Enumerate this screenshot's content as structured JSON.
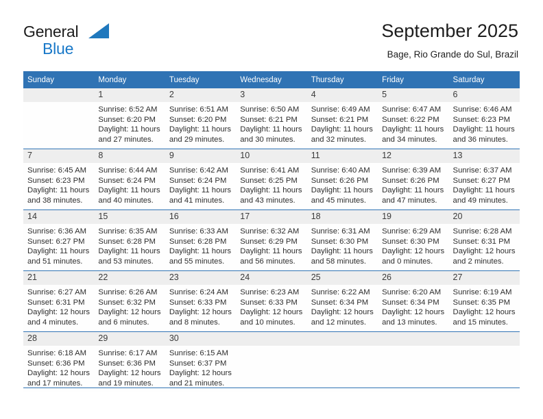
{
  "brand": {
    "name_top": "General",
    "name_bottom": "Blue",
    "triangle_icon": "blue-triangle-icon",
    "color_top": "#1c1c1c",
    "color_bottom": "#1878c8"
  },
  "header": {
    "title": "September 2025",
    "subtitle": "Bage, Rio Grande do Sul, Brazil"
  },
  "theme": {
    "header_blue": "#3073b4",
    "daynum_band": "#eeeeee",
    "text": "#2d2d2d"
  },
  "weekdays": [
    "Sunday",
    "Monday",
    "Tuesday",
    "Wednesday",
    "Thursday",
    "Friday",
    "Saturday"
  ],
  "weeks": [
    [
      {
        "day": "",
        "sunrise": "",
        "sunset": "",
        "daylight_line1": "",
        "daylight_line2": ""
      },
      {
        "day": "1",
        "sunrise": "Sunrise: 6:52 AM",
        "sunset": "Sunset: 6:20 PM",
        "daylight_line1": "Daylight: 11 hours",
        "daylight_line2": "and 27 minutes."
      },
      {
        "day": "2",
        "sunrise": "Sunrise: 6:51 AM",
        "sunset": "Sunset: 6:20 PM",
        "daylight_line1": "Daylight: 11 hours",
        "daylight_line2": "and 29 minutes."
      },
      {
        "day": "3",
        "sunrise": "Sunrise: 6:50 AM",
        "sunset": "Sunset: 6:21 PM",
        "daylight_line1": "Daylight: 11 hours",
        "daylight_line2": "and 30 minutes."
      },
      {
        "day": "4",
        "sunrise": "Sunrise: 6:49 AM",
        "sunset": "Sunset: 6:21 PM",
        "daylight_line1": "Daylight: 11 hours",
        "daylight_line2": "and 32 minutes."
      },
      {
        "day": "5",
        "sunrise": "Sunrise: 6:47 AM",
        "sunset": "Sunset: 6:22 PM",
        "daylight_line1": "Daylight: 11 hours",
        "daylight_line2": "and 34 minutes."
      },
      {
        "day": "6",
        "sunrise": "Sunrise: 6:46 AM",
        "sunset": "Sunset: 6:23 PM",
        "daylight_line1": "Daylight: 11 hours",
        "daylight_line2": "and 36 minutes."
      }
    ],
    [
      {
        "day": "7",
        "sunrise": "Sunrise: 6:45 AM",
        "sunset": "Sunset: 6:23 PM",
        "daylight_line1": "Daylight: 11 hours",
        "daylight_line2": "and 38 minutes."
      },
      {
        "day": "8",
        "sunrise": "Sunrise: 6:44 AM",
        "sunset": "Sunset: 6:24 PM",
        "daylight_line1": "Daylight: 11 hours",
        "daylight_line2": "and 40 minutes."
      },
      {
        "day": "9",
        "sunrise": "Sunrise: 6:42 AM",
        "sunset": "Sunset: 6:24 PM",
        "daylight_line1": "Daylight: 11 hours",
        "daylight_line2": "and 41 minutes."
      },
      {
        "day": "10",
        "sunrise": "Sunrise: 6:41 AM",
        "sunset": "Sunset: 6:25 PM",
        "daylight_line1": "Daylight: 11 hours",
        "daylight_line2": "and 43 minutes."
      },
      {
        "day": "11",
        "sunrise": "Sunrise: 6:40 AM",
        "sunset": "Sunset: 6:26 PM",
        "daylight_line1": "Daylight: 11 hours",
        "daylight_line2": "and 45 minutes."
      },
      {
        "day": "12",
        "sunrise": "Sunrise: 6:39 AM",
        "sunset": "Sunset: 6:26 PM",
        "daylight_line1": "Daylight: 11 hours",
        "daylight_line2": "and 47 minutes."
      },
      {
        "day": "13",
        "sunrise": "Sunrise: 6:37 AM",
        "sunset": "Sunset: 6:27 PM",
        "daylight_line1": "Daylight: 11 hours",
        "daylight_line2": "and 49 minutes."
      }
    ],
    [
      {
        "day": "14",
        "sunrise": "Sunrise: 6:36 AM",
        "sunset": "Sunset: 6:27 PM",
        "daylight_line1": "Daylight: 11 hours",
        "daylight_line2": "and 51 minutes."
      },
      {
        "day": "15",
        "sunrise": "Sunrise: 6:35 AM",
        "sunset": "Sunset: 6:28 PM",
        "daylight_line1": "Daylight: 11 hours",
        "daylight_line2": "and 53 minutes."
      },
      {
        "day": "16",
        "sunrise": "Sunrise: 6:33 AM",
        "sunset": "Sunset: 6:28 PM",
        "daylight_line1": "Daylight: 11 hours",
        "daylight_line2": "and 55 minutes."
      },
      {
        "day": "17",
        "sunrise": "Sunrise: 6:32 AM",
        "sunset": "Sunset: 6:29 PM",
        "daylight_line1": "Daylight: 11 hours",
        "daylight_line2": "and 56 minutes."
      },
      {
        "day": "18",
        "sunrise": "Sunrise: 6:31 AM",
        "sunset": "Sunset: 6:30 PM",
        "daylight_line1": "Daylight: 11 hours",
        "daylight_line2": "and 58 minutes."
      },
      {
        "day": "19",
        "sunrise": "Sunrise: 6:29 AM",
        "sunset": "Sunset: 6:30 PM",
        "daylight_line1": "Daylight: 12 hours",
        "daylight_line2": "and 0 minutes."
      },
      {
        "day": "20",
        "sunrise": "Sunrise: 6:28 AM",
        "sunset": "Sunset: 6:31 PM",
        "daylight_line1": "Daylight: 12 hours",
        "daylight_line2": "and 2 minutes."
      }
    ],
    [
      {
        "day": "21",
        "sunrise": "Sunrise: 6:27 AM",
        "sunset": "Sunset: 6:31 PM",
        "daylight_line1": "Daylight: 12 hours",
        "daylight_line2": "and 4 minutes."
      },
      {
        "day": "22",
        "sunrise": "Sunrise: 6:26 AM",
        "sunset": "Sunset: 6:32 PM",
        "daylight_line1": "Daylight: 12 hours",
        "daylight_line2": "and 6 minutes."
      },
      {
        "day": "23",
        "sunrise": "Sunrise: 6:24 AM",
        "sunset": "Sunset: 6:33 PM",
        "daylight_line1": "Daylight: 12 hours",
        "daylight_line2": "and 8 minutes."
      },
      {
        "day": "24",
        "sunrise": "Sunrise: 6:23 AM",
        "sunset": "Sunset: 6:33 PM",
        "daylight_line1": "Daylight: 12 hours",
        "daylight_line2": "and 10 minutes."
      },
      {
        "day": "25",
        "sunrise": "Sunrise: 6:22 AM",
        "sunset": "Sunset: 6:34 PM",
        "daylight_line1": "Daylight: 12 hours",
        "daylight_line2": "and 12 minutes."
      },
      {
        "day": "26",
        "sunrise": "Sunrise: 6:20 AM",
        "sunset": "Sunset: 6:34 PM",
        "daylight_line1": "Daylight: 12 hours",
        "daylight_line2": "and 13 minutes."
      },
      {
        "day": "27",
        "sunrise": "Sunrise: 6:19 AM",
        "sunset": "Sunset: 6:35 PM",
        "daylight_line1": "Daylight: 12 hours",
        "daylight_line2": "and 15 minutes."
      }
    ],
    [
      {
        "day": "28",
        "sunrise": "Sunrise: 6:18 AM",
        "sunset": "Sunset: 6:36 PM",
        "daylight_line1": "Daylight: 12 hours",
        "daylight_line2": "and 17 minutes."
      },
      {
        "day": "29",
        "sunrise": "Sunrise: 6:17 AM",
        "sunset": "Sunset: 6:36 PM",
        "daylight_line1": "Daylight: 12 hours",
        "daylight_line2": "and 19 minutes."
      },
      {
        "day": "30",
        "sunrise": "Sunrise: 6:15 AM",
        "sunset": "Sunset: 6:37 PM",
        "daylight_line1": "Daylight: 12 hours",
        "daylight_line2": "and 21 minutes."
      },
      {
        "day": "",
        "sunrise": "",
        "sunset": "",
        "daylight_line1": "",
        "daylight_line2": ""
      },
      {
        "day": "",
        "sunrise": "",
        "sunset": "",
        "daylight_line1": "",
        "daylight_line2": ""
      },
      {
        "day": "",
        "sunrise": "",
        "sunset": "",
        "daylight_line1": "",
        "daylight_line2": ""
      },
      {
        "day": "",
        "sunrise": "",
        "sunset": "",
        "daylight_line1": "",
        "daylight_line2": ""
      }
    ]
  ]
}
